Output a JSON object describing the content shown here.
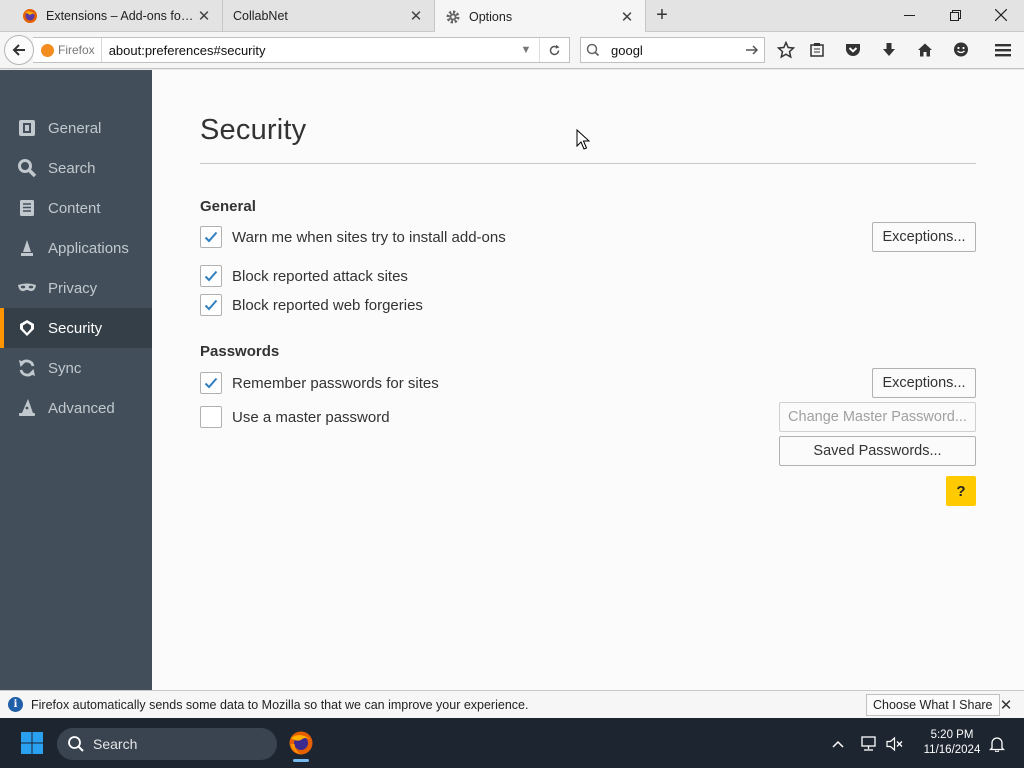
{
  "browser": {
    "tabs": [
      {
        "title": "Extensions – Add-ons for ..."
      },
      {
        "title": "CollabNet"
      },
      {
        "title": "Options"
      }
    ],
    "identity_label": "Firefox",
    "url": "about:preferences#security",
    "search_query": "googl"
  },
  "sidebar": {
    "items": [
      {
        "label": "General",
        "icon": "general-icon"
      },
      {
        "label": "Search",
        "icon": "search-icon"
      },
      {
        "label": "Content",
        "icon": "content-icon"
      },
      {
        "label": "Applications",
        "icon": "applications-icon"
      },
      {
        "label": "Privacy",
        "icon": "privacy-mask-icon"
      },
      {
        "label": "Security",
        "icon": "security-lock-icon",
        "selected": true
      },
      {
        "label": "Sync",
        "icon": "sync-icon"
      },
      {
        "label": "Advanced",
        "icon": "advanced-wizard-hat-icon"
      }
    ]
  },
  "page": {
    "title": "Security",
    "general": {
      "heading": "General",
      "warn_addons": {
        "label": "Warn me when sites try to install add-ons",
        "checked": true
      },
      "exceptions_label": "Exceptions...",
      "block_attack": {
        "label": "Block reported attack sites",
        "checked": true
      },
      "block_forgeries": {
        "label": "Block reported web forgeries",
        "checked": true
      }
    },
    "passwords": {
      "heading": "Passwords",
      "remember": {
        "label": "Remember passwords for sites",
        "checked": true
      },
      "exceptions_label": "Exceptions...",
      "master": {
        "label": "Use a master password",
        "checked": false
      },
      "change_master_label": "Change Master Password...",
      "saved_label": "Saved Passwords..."
    },
    "help_label": "?"
  },
  "notification": {
    "text": "Firefox automatically sends some data to Mozilla so that we can improve your experience.",
    "button_label": "Choose What I Share"
  },
  "taskbar": {
    "search_label": "Search",
    "time": "5:20 PM",
    "date": "11/16/2024"
  },
  "colors": {
    "sidebar_bg": "#424f5a",
    "selected_accent": "#ff9500",
    "check_color": "#2f7fc1",
    "help_bg": "#ffcb00"
  }
}
